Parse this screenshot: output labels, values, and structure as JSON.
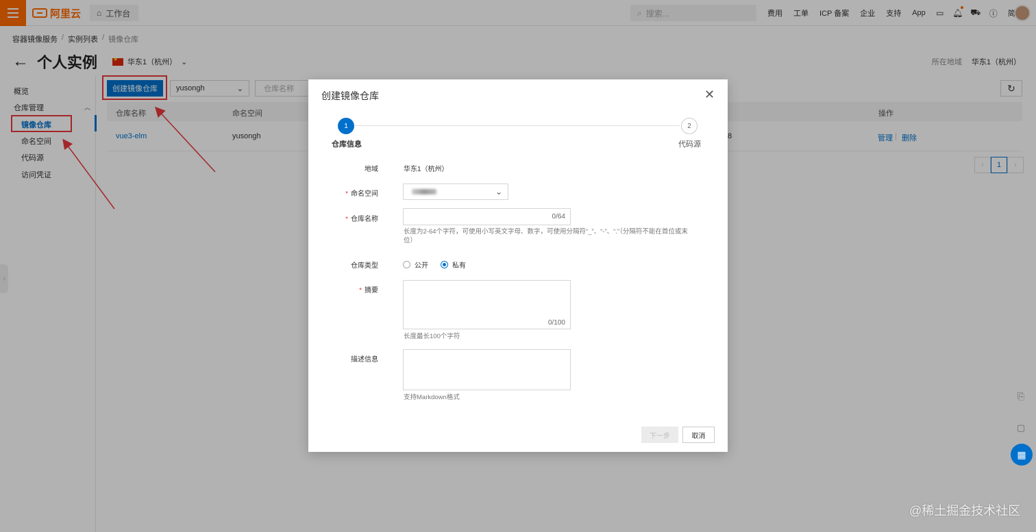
{
  "topbar": {
    "brand": "阿里云",
    "workbench": "工作台",
    "search_placeholder": "搜索...",
    "links": [
      "费用",
      "工单",
      "ICP 备案",
      "企业",
      "支持",
      "App"
    ],
    "language": "简体"
  },
  "breadcrumb": [
    "容器镜像服务",
    "实例列表",
    "镜像仓库"
  ],
  "page": {
    "title": "个人实例",
    "region": "华东1（杭州）",
    "region_label": "所在地域",
    "region_value": "华东1（杭州）"
  },
  "sidebar": {
    "overview": "概览",
    "group": "仓库管理",
    "items": [
      "镜像仓库",
      "命名空间",
      "代码源",
      "访问凭证"
    ]
  },
  "toolbar": {
    "create_button": "创建镜像仓库",
    "namespace": "yusongh",
    "repo_placeholder": "仓库名称"
  },
  "table": {
    "columns": [
      "仓库名称",
      "命名空间",
      "操作"
    ],
    "rows": [
      {
        "name": "vue3-elm",
        "namespace": "yusongh",
        "partial": "8",
        "manage": "管理",
        "delete": "删除"
      }
    ]
  },
  "pager": {
    "prev": "‹",
    "current": "1",
    "next": "›"
  },
  "dialog": {
    "title": "创建镜像仓库",
    "steps": [
      {
        "number": "1",
        "label": "仓库信息"
      },
      {
        "number": "2",
        "label": "代码源"
      }
    ],
    "fields": {
      "region_label": "地域",
      "region_value": "华东1（杭州）",
      "namespace_label": "命名空间",
      "repo_name_label": "仓库名称",
      "repo_name_counter": "0/64",
      "repo_name_hint": "长度为2-64个字符，可使用小写英文字母、数字，可使用分隔符“_”、“-”、“.”（分隔符不能在首位或末位）",
      "repo_type_label": "仓库类型",
      "repo_type_public": "公开",
      "repo_type_private": "私有",
      "summary_label": "摘要",
      "summary_counter": "0/100",
      "summary_hint": "长度最长100个字符",
      "description_label": "描述信息",
      "description_hint": "支持Markdown格式"
    },
    "next_button": "下一步",
    "cancel_button": "取消"
  },
  "watermark": "@稀土掘金技术社区",
  "colors": {
    "brand": "#ff6a00",
    "primary": "#0070cc",
    "annotation": "#e8383d"
  }
}
